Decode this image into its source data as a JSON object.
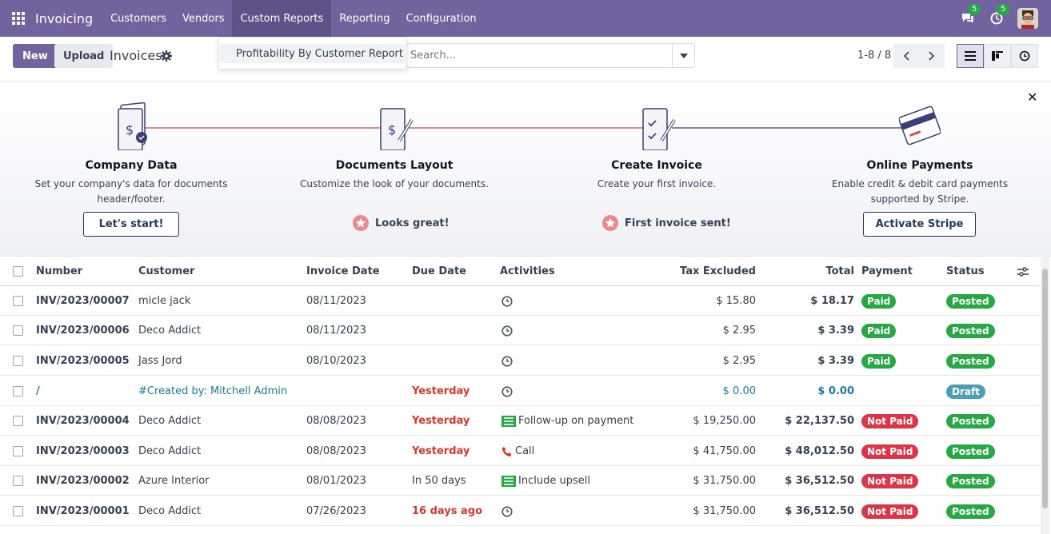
{
  "nav": {
    "app_name": "Invoicing",
    "items": [
      "Customers",
      "Vendors",
      "Custom Reports",
      "Reporting",
      "Configuration"
    ],
    "messages_count": "5",
    "activities_count": "5"
  },
  "control": {
    "new_label": "New",
    "upload_label": "Upload",
    "title": "Invoices",
    "search_placeholder": "Search...",
    "pager": "1-8 / 8"
  },
  "dropdown": {
    "item": "Profitability By Customer Report"
  },
  "onboarding": {
    "steps": [
      {
        "title": "Company Data",
        "desc": "Set your company's data for documents header/footer.",
        "action": "Let's start!"
      },
      {
        "title": "Documents Layout",
        "desc": "Customize the look of your documents.",
        "done": "Looks great!"
      },
      {
        "title": "Create Invoice",
        "desc": "Create your first invoice.",
        "done": "First invoice sent!"
      },
      {
        "title": "Online Payments",
        "desc": "Enable credit & debit card payments supported by Stripe.",
        "action": "Activate Stripe"
      }
    ]
  },
  "table": {
    "headers": {
      "number": "Number",
      "customer": "Customer",
      "invoice_date": "Invoice Date",
      "due_date": "Due Date",
      "activities": "Activities",
      "tax_excluded": "Tax Excluded",
      "total": "Total",
      "payment": "Payment",
      "status": "Status"
    },
    "rows": [
      {
        "number": "INV/2023/00007",
        "customer": "micle jack",
        "invoice_date": "08/11/2023",
        "due_date": "",
        "activity": "",
        "tax_excluded": "$ 15.80",
        "total": "$ 18.17",
        "payment": "Paid",
        "status": "Posted"
      },
      {
        "number": "INV/2023/00006",
        "customer": "Deco Addict",
        "invoice_date": "08/11/2023",
        "due_date": "",
        "activity": "",
        "tax_excluded": "$ 2.95",
        "total": "$ 3.39",
        "payment": "Paid",
        "status": "Posted"
      },
      {
        "number": "INV/2023/00005",
        "customer": "Jass Jord",
        "invoice_date": "08/10/2023",
        "due_date": "",
        "activity": "",
        "tax_excluded": "$ 2.95",
        "total": "$ 3.39",
        "payment": "Paid",
        "status": "Posted"
      },
      {
        "number": "/",
        "customer": "#Created by: Mitchell Admin",
        "invoice_date": "",
        "due_date": "Yesterday",
        "activity": "",
        "tax_excluded": "$ 0.00",
        "total": "$ 0.00",
        "payment": "",
        "status": "Draft"
      },
      {
        "number": "INV/2023/00004",
        "customer": "Deco Addict",
        "invoice_date": "08/08/2023",
        "due_date": "Yesterday",
        "activity": "Follow-up on payment",
        "tax_excluded": "$ 19,250.00",
        "total": "$ 22,137.50",
        "payment": "Not Paid",
        "status": "Posted"
      },
      {
        "number": "INV/2023/00003",
        "customer": "Deco Addict",
        "invoice_date": "08/08/2023",
        "due_date": "Yesterday",
        "activity": "Call",
        "tax_excluded": "$ 41,750.00",
        "total": "$ 48,012.50",
        "payment": "Not Paid",
        "status": "Posted"
      },
      {
        "number": "INV/2023/00002",
        "customer": "Azure Interior",
        "invoice_date": "08/01/2023",
        "due_date": "In 50 days",
        "activity": "Include upsell",
        "tax_excluded": "$ 31,750.00",
        "total": "$ 36,512.50",
        "payment": "Not Paid",
        "status": "Posted"
      },
      {
        "number": "INV/2023/00001",
        "customer": "Deco Addict",
        "invoice_date": "07/26/2023",
        "due_date": "16 days ago",
        "activity": "",
        "tax_excluded": "$ 31,750.00",
        "total": "$ 36,512.50",
        "payment": "Not Paid",
        "status": "Posted"
      }
    ]
  },
  "colors": {
    "brand": "#71639e",
    "paid": "#28a745",
    "not_paid": "#dc3545",
    "draft": "#4a9fb5"
  }
}
